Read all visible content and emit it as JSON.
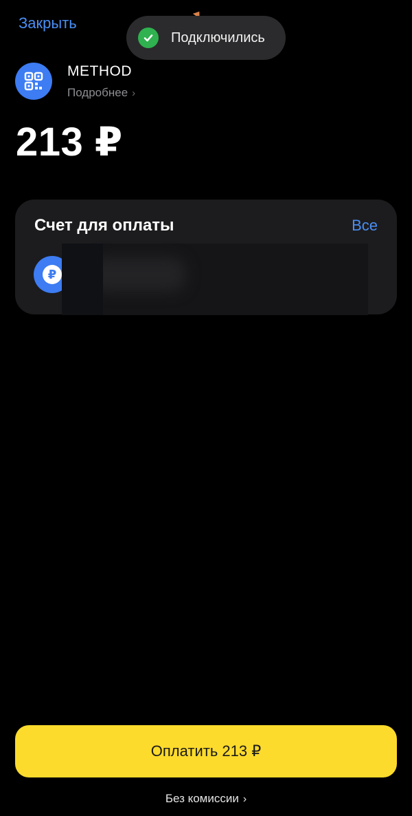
{
  "header": {
    "close_label": "Закрыть"
  },
  "toast": {
    "message": "Подключились",
    "icon": "check-circle-icon",
    "color": "#2fb24f"
  },
  "merchant": {
    "name": "METHOD",
    "details_label": "Подробнее",
    "logo_icon": "qr-code-icon",
    "logo_color": "#3d7cf2"
  },
  "payment": {
    "amount": "213 ₽"
  },
  "account_card": {
    "title": "Счет для оплаты",
    "all_label": "Все",
    "account_icon": "ruble-icon"
  },
  "footer": {
    "pay_button_label": "Оплатить 213 ₽",
    "pay_button_color": "#fddb2c",
    "fee_note": "Без комиссии"
  },
  "colors": {
    "accent_link": "#4a8ff5",
    "background": "#000000",
    "card_background": "#1c1c1e"
  }
}
